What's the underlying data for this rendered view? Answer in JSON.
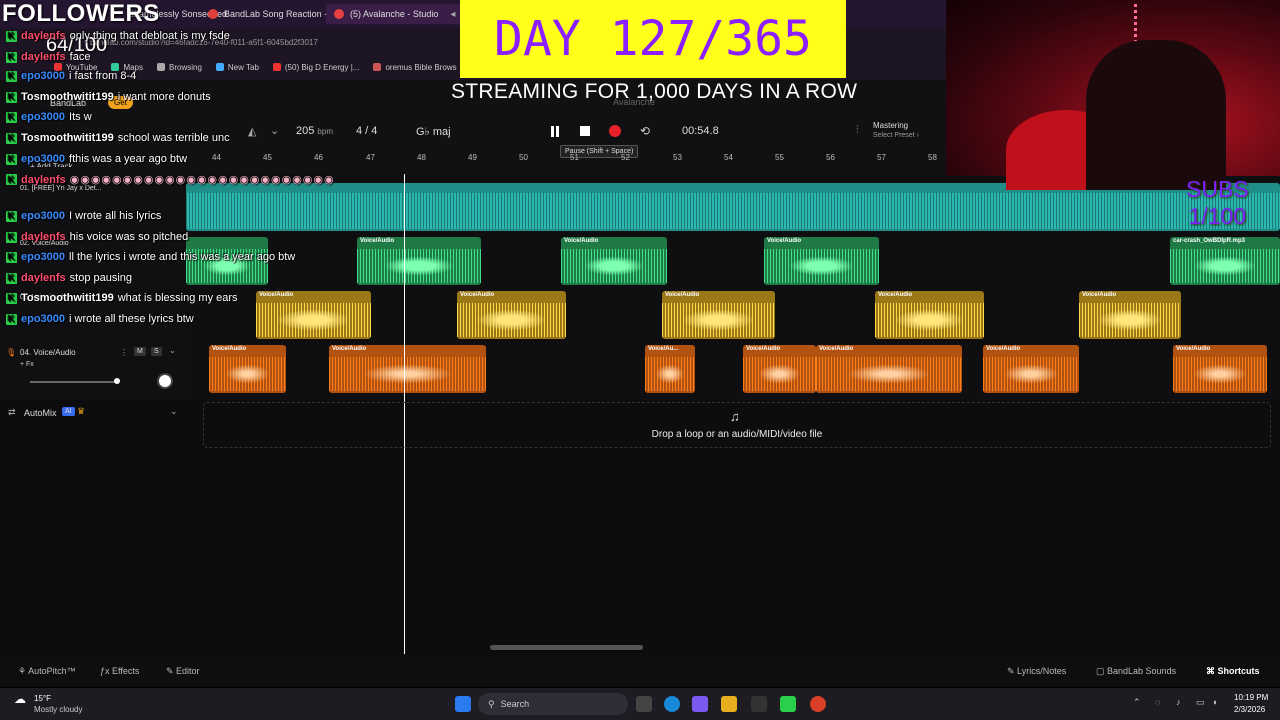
{
  "browser": {
    "tabs": [
      {
        "label": "Shamelessly Sonseeded",
        "closable": false
      },
      {
        "label": "BandLab Song Reaction - hunte",
        "closable": true
      },
      {
        "label": "(5) Avalanche - Studio",
        "closable": true
      }
    ],
    "url": "bandlab.com/studio?id=46fadc16-7e40-f011-a5f1-6045bd2f3017",
    "bookmarks": [
      "YouTube",
      "Maps",
      "Browsing",
      "New Tab",
      "(50) Big D Energy |...",
      "oremus Bible Brows"
    ]
  },
  "overlay": {
    "followers_title": "FOLLOWERS",
    "followers_count": "64/100",
    "day_banner": "DAY 127/365",
    "streaming_text": "STREAMING FOR 1,000 DAYS IN A ROW",
    "subs_title": "SUBS",
    "subs_count": "1/100"
  },
  "chat": [
    {
      "user": "daylenfs",
      "msg": "only thing that debloat is my fsde",
      "color": "#ff4f6e"
    },
    {
      "user": "daylenfs",
      "msg": "face",
      "color": "#ff4f6e"
    },
    {
      "user": "epo3000",
      "msg": "i fast from 8-4",
      "color": "#3a8cff"
    },
    {
      "user": "Tosmoothwitit199",
      "msg": "i want more donuts",
      "color": "#ffffff"
    },
    {
      "user": "epo3000",
      "msg": "Its w",
      "color": "#3a8cff"
    },
    {
      "user": "Tosmoothwitit199",
      "msg": "school was terrible unc",
      "color": "#ffffff"
    },
    {
      "user": "epo3000",
      "msg": "fthis was a year ago btw",
      "color": "#3a8cff"
    },
    {
      "user": "daylenfs",
      "msg": "",
      "color": "#ff4f6e"
    },
    {
      "user": "epo3000",
      "msg": "I wrote all his lyrics",
      "color": "#3a8cff"
    },
    {
      "user": "daylenfs",
      "msg": "his voice was so pitched",
      "color": "#ff4f6e"
    },
    {
      "user": "epo3000",
      "msg": "ll the lyrics i wrote and this was a year ago btw",
      "color": "#3a8cff"
    },
    {
      "user": "daylenfs",
      "msg": "stop pausing",
      "color": "#ff4f6e"
    },
    {
      "user": "Tosmoothwitit199",
      "msg": "what is blessing my ears",
      "color": "#ffffff"
    },
    {
      "user": "epo3000",
      "msg": "i wrote all these lyrics btw",
      "color": "#3a8cff"
    }
  ],
  "daw": {
    "project_title": "Avalanche",
    "bpm": "205",
    "bpm_unit": "bpm",
    "time_signature": "4 / 4",
    "key": "maj",
    "time": "00:54.8",
    "tooltip": "Pause (Shift + Space)",
    "mastering_label": "Mastering",
    "mastering_preset": "Select Preset",
    "add_track": "Add Track",
    "get_label": "Get",
    "bandlab_label": "BandLab",
    "ruler": [
      "44",
      "45",
      "46",
      "47",
      "48",
      "49",
      "50",
      "51",
      "52",
      "53",
      "54",
      "55",
      "56",
      "57",
      "58"
    ],
    "tracks": [
      {
        "name": "01. [FREE] Yn Jay x Det...",
        "color": "#2ab8b0"
      },
      {
        "name": "02. Voice/Audio",
        "color": "#3ee08a"
      },
      {
        "name": "03. Voice/Audio",
        "color": "#e8b82a"
      },
      {
        "name": "04. Voice/Audio",
        "color": "#ff7d1a"
      }
    ],
    "track_fx": "+ Fx",
    "mute": "M",
    "solo": "S",
    "clip_voice": "Voice/Audio",
    "clip_voice_short": "Voice/Au...",
    "clip_crash": "car-crash_OwBDIpR.mp3",
    "drop_text": "Drop a loop or an audio/MIDI/video file",
    "automix": "AutoMix",
    "ai_badge": "AI",
    "bottom": {
      "autopitch": "AutoPitch™",
      "effects": "Effects",
      "editor": "Editor",
      "lyrics": "Lyrics/Notes",
      "sounds": "BandLab Sounds",
      "shortcuts": "Shortcuts"
    }
  },
  "taskbar": {
    "weather_temp": "15°F",
    "weather_desc": "Mostly cloudy",
    "search": "Search",
    "time": "10:19 PM",
    "date": "2/3/2026"
  }
}
